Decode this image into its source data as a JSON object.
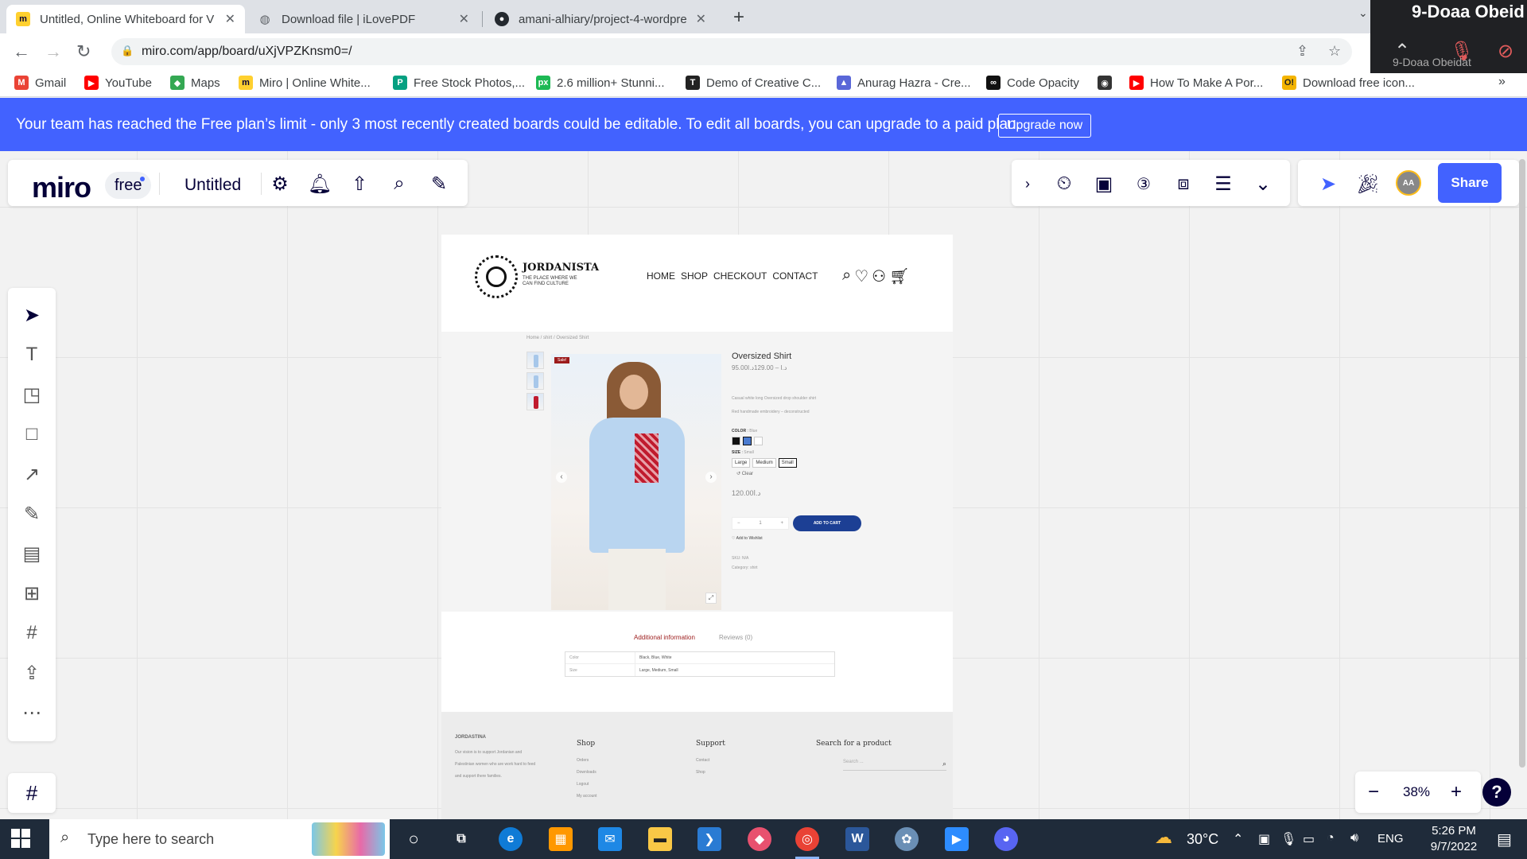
{
  "browser": {
    "tabs": [
      {
        "title": "Untitled, Online Whiteboard for V",
        "icon": "miro-icon"
      },
      {
        "title": "Download file | iLovePDF",
        "icon": "globe-icon"
      },
      {
        "title": "amani-alhiary/project-4-wordpre",
        "icon": "github-icon"
      }
    ],
    "url": "miro.com/app/board/uXjVPZKnsm0=/",
    "bookmarks": [
      {
        "label": "Gmail",
        "color": "#ea4335",
        "glyph": "M"
      },
      {
        "label": "YouTube",
        "color": "#ff0000",
        "glyph": "▶"
      },
      {
        "label": "Maps",
        "color": "#34a853",
        "glyph": "◆"
      },
      {
        "label": "Miro | Online White...",
        "color": "#050038",
        "glyph": "m"
      },
      {
        "label": "Free Stock Photos,...",
        "color": "#05a081",
        "glyph": "P"
      },
      {
        "label": "2.6 million+ Stunni...",
        "color": "#1db954",
        "glyph": "px"
      },
      {
        "label": "Demo of Creative C...",
        "color": "#222222",
        "glyph": "T"
      },
      {
        "label": "Anurag Hazra - Cre...",
        "color": "#5a67d8",
        "glyph": "▲"
      },
      {
        "label": "Code Opacity",
        "color": "#111111",
        "glyph": "∞"
      },
      {
        "label": "",
        "color": "#333333",
        "glyph": "◉"
      },
      {
        "label": "How To Make A Por...",
        "color": "#ff0000",
        "glyph": "▶"
      },
      {
        "label": "Download free icon...",
        "color": "#f4b400",
        "glyph": "O!"
      }
    ]
  },
  "meeting": {
    "name": "9-Doaa Obeid",
    "sub": "9-Doaa Obeidat"
  },
  "banner": {
    "message": "Your team has reached the Free plan’s limit - only 3 most recently created boards could be editable. To edit all boards, you can upgrade to a paid plan.",
    "button": "Upgrade now"
  },
  "miro": {
    "logo": "miro",
    "plan": "free",
    "board_title": "Untitled",
    "share": "Share",
    "avatar": "AA",
    "zoom": "38%",
    "accent": "#4262ff"
  },
  "site": {
    "brand": "JORDANISTA",
    "tagline": "THE PLACE WHERE WE CAN FIND CULTURE",
    "nav": [
      "HOME",
      "SHOP",
      "CHECKOUT",
      "CONTACT"
    ],
    "breadcrumb": "Home / shirt / Oversized Shirt",
    "sale": "Sale!",
    "product": {
      "title": "Oversized Shirt",
      "price_range": "95.00د.ا – 129.00د.ا",
      "desc1": "Casual white long Oversized drop shoulder shirt",
      "desc2": "Red handmade embroidery – deconstructed",
      "color_label": "COLOR",
      "color_value": "Blue",
      "size_label": "SIZE",
      "size_value": "Small",
      "sizes": [
        "Large",
        "Medium",
        "Small"
      ],
      "clear": "↺ Clear",
      "price": "120.00د.ا",
      "qty": "1",
      "add_to_cart": "ADD TO CART",
      "wishlist": "♡ Add to Wishlist",
      "sku": "SKU: N/A",
      "category": "Category: shirt"
    },
    "tabs": [
      "Additional information",
      "Reviews (0)"
    ],
    "attributes": [
      {
        "key": "Color",
        "value": "Black, Blue, White"
      },
      {
        "key": "Size",
        "value": "Large, Medium, Small"
      }
    ],
    "footer": {
      "brand": "JORDASTINA",
      "about": "Our vision is to support Jordanian and Palestinian women who are work hard to feed and support there families.",
      "shop_title": "Shop",
      "shop_links": [
        "Orders",
        "Downloads",
        "Logout",
        "My account"
      ],
      "support_title": "Support",
      "support_links": [
        "Contact",
        "Shop"
      ],
      "search_title": "Search for a product",
      "search_placeholder": "Search ..."
    }
  },
  "taskbar": {
    "search_placeholder": "Type here to search",
    "weather": "30°C",
    "lang": "ENG",
    "time": "5:26 PM",
    "date": "9/7/2022"
  }
}
